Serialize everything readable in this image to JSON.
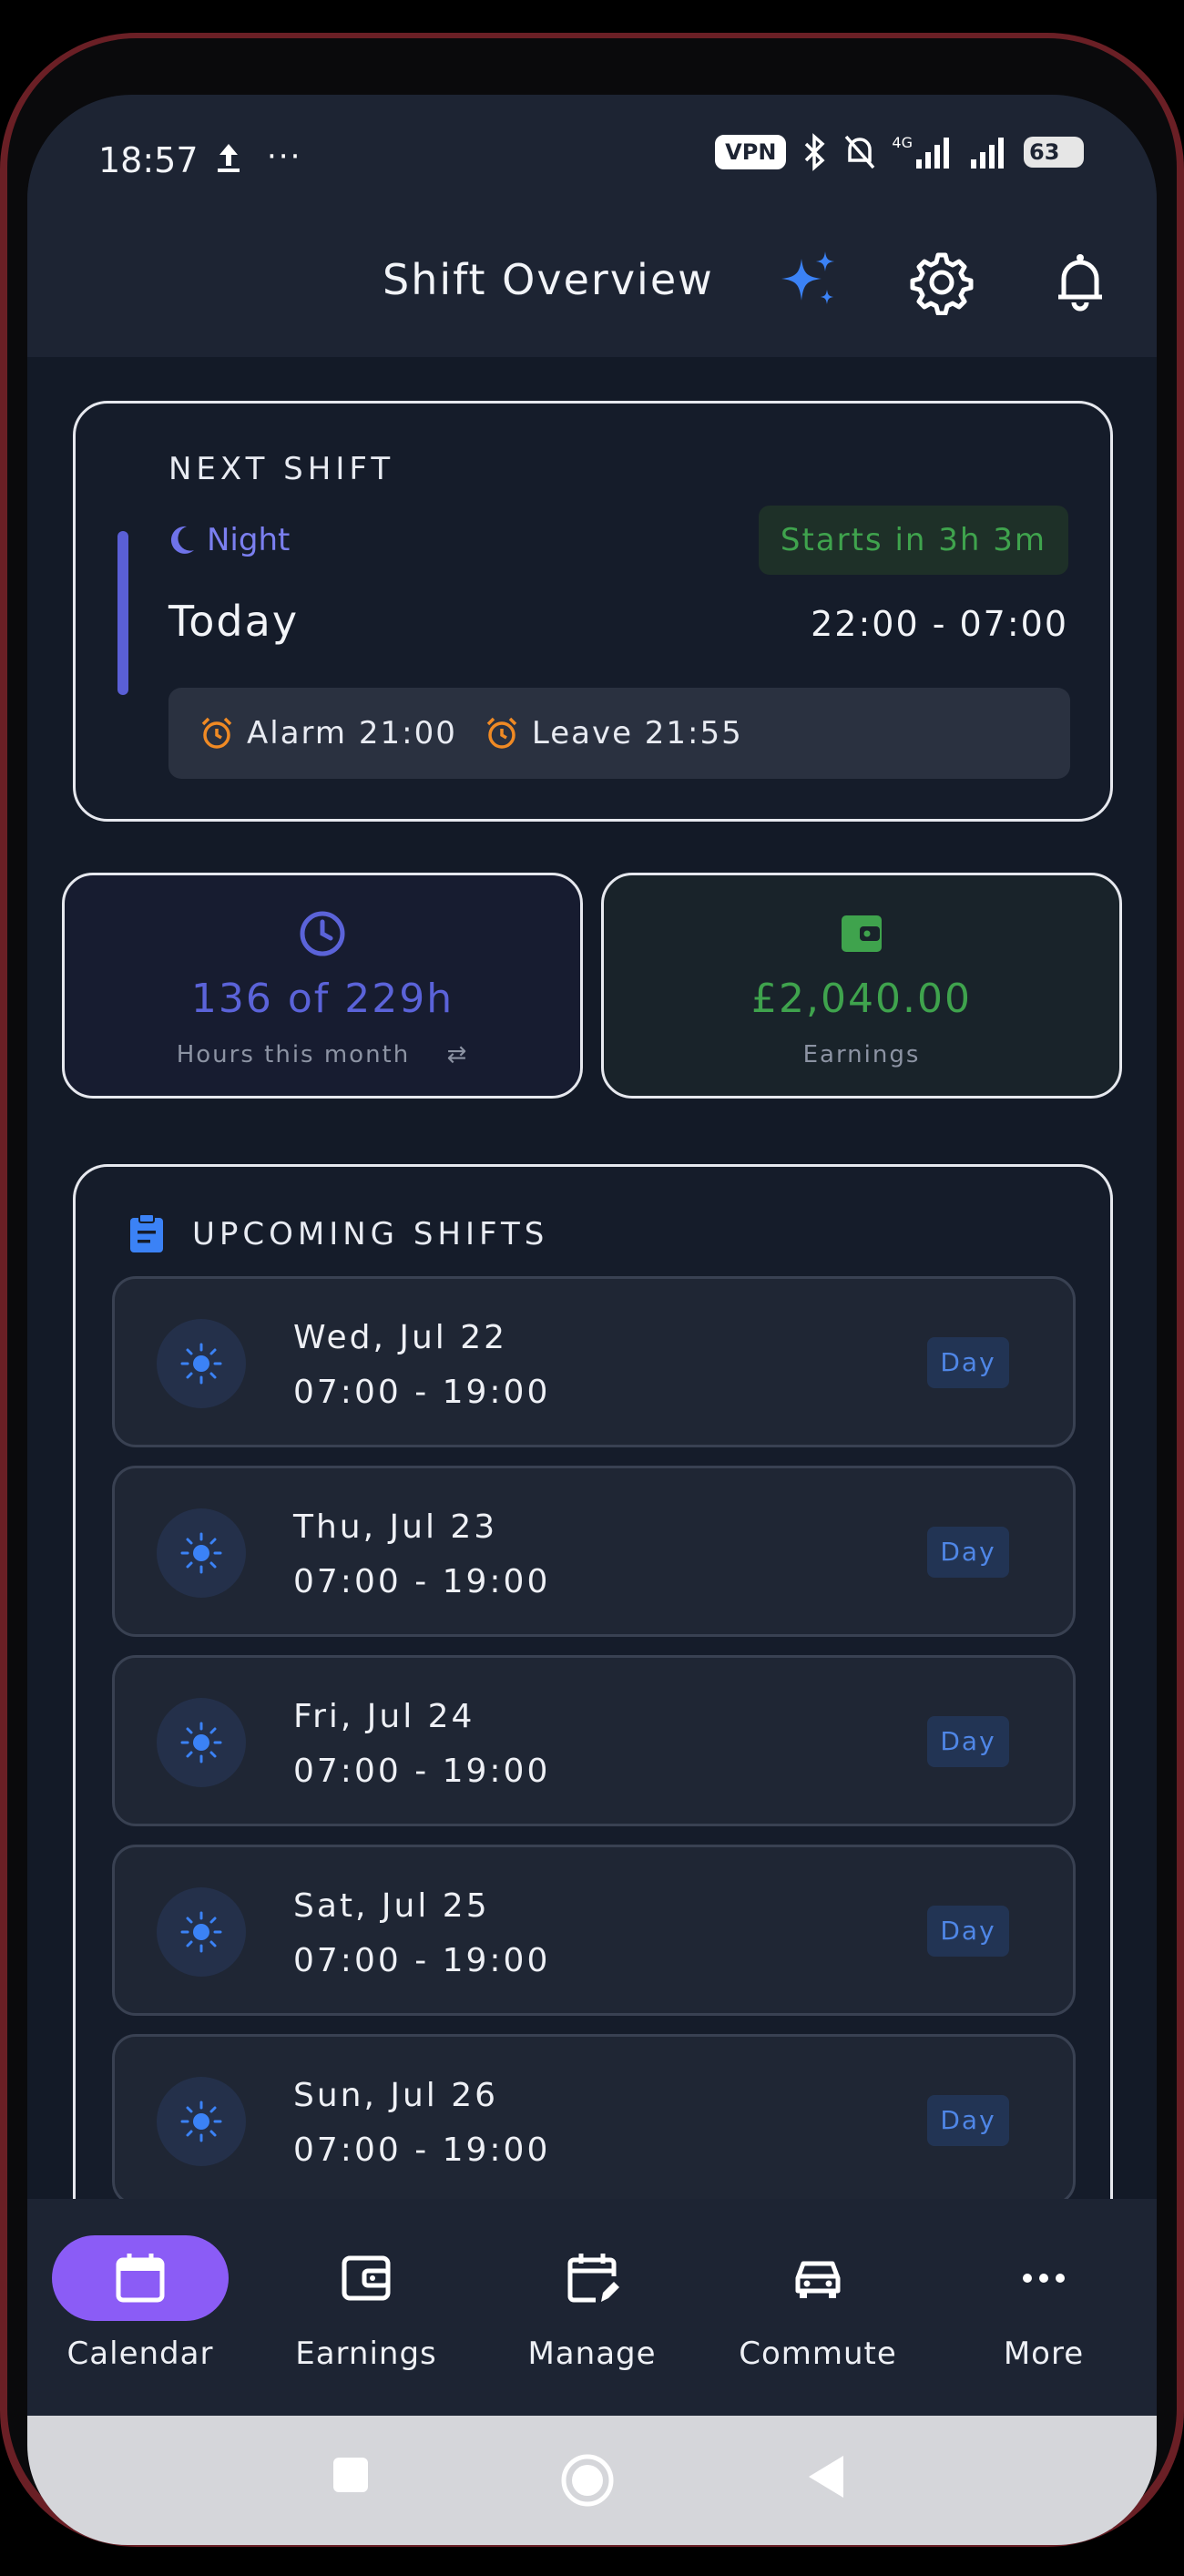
{
  "status_bar": {
    "time": "18:57",
    "vpn": "VPN",
    "network": "4G",
    "battery": "63"
  },
  "header": {
    "title": "Shift Overview"
  },
  "next_shift": {
    "label": "NEXT SHIFT",
    "type": "Night",
    "starts_in": "Starts in 3h 3m",
    "day": "Today",
    "time_range": "22:00 - 07:00",
    "alarm": "Alarm 21:00",
    "leave": "Leave 21:55",
    "accent_color": "#5a5fd6"
  },
  "stats": {
    "hours": {
      "value": "136 of 229h",
      "caption": "Hours this month",
      "swap_glyph": "⇄",
      "color": "#5b63d9"
    },
    "earnings": {
      "value": "£2,040.00",
      "caption": "Earnings",
      "color": "#3fa34d"
    }
  },
  "upcoming": {
    "title": "UPCOMING SHIFTS",
    "shifts": [
      {
        "date": "Wed, Jul 22",
        "time": "07:00 - 19:00",
        "badge": "Day"
      },
      {
        "date": "Thu, Jul 23",
        "time": "07:00 - 19:00",
        "badge": "Day"
      },
      {
        "date": "Fri, Jul 24",
        "time": "07:00 - 19:00",
        "badge": "Day"
      },
      {
        "date": "Sat, Jul 25",
        "time": "07:00 - 19:00",
        "badge": "Day"
      },
      {
        "date": "Sun, Jul 26",
        "time": "07:00 - 19:00",
        "badge": "Day"
      }
    ]
  },
  "nav": {
    "items": [
      {
        "label": "Calendar",
        "icon": "calendar-icon",
        "active": true
      },
      {
        "label": "Earnings",
        "icon": "wallet-icon",
        "active": false
      },
      {
        "label": "Manage",
        "icon": "calendar-edit-icon",
        "active": false
      },
      {
        "label": "Commute",
        "icon": "car-icon",
        "active": false
      },
      {
        "label": "More",
        "icon": "more-dots-icon",
        "active": false
      }
    ],
    "active_color": "#8b5cf6"
  }
}
